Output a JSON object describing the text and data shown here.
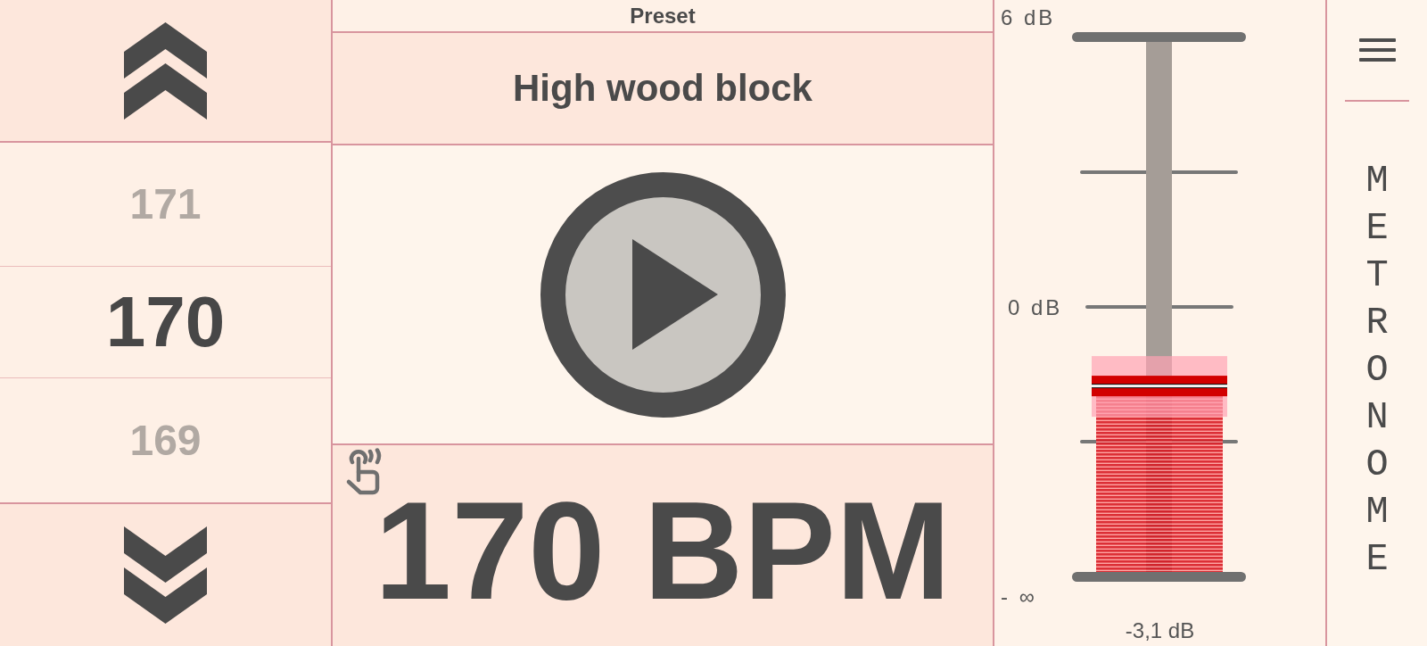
{
  "tempo_picker": {
    "options": [
      {
        "value": "171",
        "selected": false
      },
      {
        "value": "170",
        "selected": true
      },
      {
        "value": "169",
        "selected": false
      }
    ]
  },
  "preset": {
    "label": "Preset",
    "name": "High wood block"
  },
  "tempo_display": {
    "text": "170 BPM"
  },
  "volume": {
    "scale_labels": [
      "6 dB",
      "0 dB",
      "- ∞"
    ],
    "level": 0.35,
    "reading": "-3,1 dB"
  },
  "sidebar": {
    "title": "METRONOME"
  }
}
